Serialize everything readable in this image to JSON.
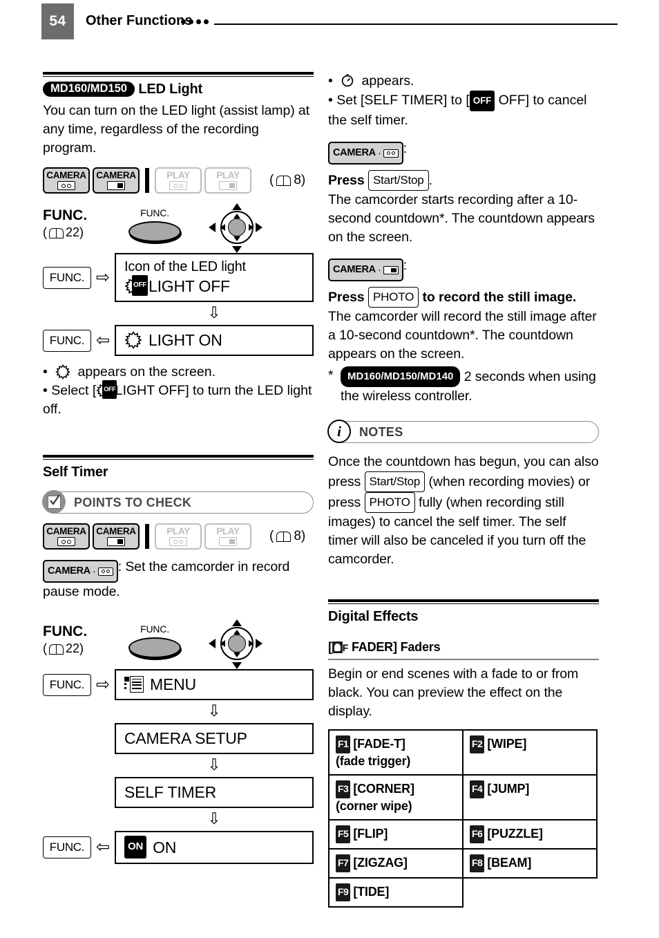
{
  "header": {
    "page_number": "54",
    "title": "Other Functions",
    "dot_count": 4
  },
  "mode_chips": {
    "camera_tape": "CAMERA",
    "camera_card": "CAMERA",
    "play_tape": "PLAY",
    "play_card": "PLAY",
    "page_ref": "8)",
    "paren_open": "("
  },
  "func_block": {
    "label": "FUNC.",
    "page_ref_open": "(",
    "page_ref": "22)",
    "button_caption": "FUNC.",
    "key_label": "FUNC."
  },
  "left_column": {
    "led_light": {
      "model_badge": "MD160/MD150",
      "heading": "LED Light",
      "body": "You can turn on the LED light (assist lamp) at any time, regardless of the recording program.",
      "flow": {
        "step1_caption": "Icon of the LED light",
        "step1_label": "LIGHT OFF",
        "step1_icon": "led-light-off-icon",
        "step2_label": "LIGHT ON",
        "step2_icon": "led-light-on-icon",
        "arrow_right": "⇨",
        "arrow_left": "⇦",
        "arrow_down": "⇩"
      },
      "notes": [
        {
          "icon": "led-light-on-icon",
          "text_after": "appears on the screen."
        },
        {
          "text_before": "Select [",
          "icon": "led-light-off-icon",
          "text_after": "LIGHT OFF]  to turn the LED light off."
        }
      ]
    },
    "self_timer": {
      "heading": "Self Timer",
      "points_to_check": "POINTS TO CHECK",
      "points_icon": "checkbox-check-icon",
      "requirement_text": ": Set the camcorder in record pause mode.",
      "flow": {
        "step1_label": "MENU",
        "step1_icon": "menu-list-icon",
        "step2_label": "CAMERA SETUP",
        "step3_label": "SELF TIMER",
        "step4_label": "ON",
        "step4_badge": "ON"
      }
    }
  },
  "right_column": {
    "self_timer_cont": {
      "bullet1_icon": "self-timer-icon",
      "bullet1_text": "appears.",
      "bullet2_before": "Set [SELF TIMER] to [",
      "bullet2_badge": "OFF",
      "bullet2_after": "OFF] to cancel the self timer.",
      "mode_tape_colon": ":",
      "press_label": "Press",
      "start_stop_key": "Start/Stop",
      "after_key_period": ".",
      "tape_body": "The camcorder starts recording after a 10-second countdown*. The countdown appears on the screen.",
      "mode_card_colon": ":",
      "photo_key": "PHOTO",
      "photo_press_bold_tail": "to record the still image.",
      "card_body": "The camcorder will record the still image after a 10-second countdown*. The countdown appears on the screen.",
      "footnote_star": "*",
      "footnote_badge": "MD160/MD150/MD140",
      "footnote_text": "2 seconds when using the wireless controller."
    },
    "notes": {
      "label": "NOTES",
      "icon": "info-circle-icon",
      "text_part1": "Once the countdown has begun, you can also press",
      "key1": "Start/Stop",
      "text_part2": "(when recording movies) or press",
      "key2": "PHOTO",
      "text_part3": "fully (when recording still images) to cancel the self timer. The self timer will also be canceled if you turn off the camcorder."
    },
    "digital_effects": {
      "heading": "Digital Effects",
      "sub_open": "[",
      "sub_icon": "fader-icon",
      "sub_icon_letter": "F",
      "sub_heading": "FADER] Faders",
      "body": "Begin or end scenes with a fade to or from black. You can preview the effect on the display.",
      "faders": [
        {
          "key": "F1",
          "label": "[FADE-T]",
          "sub": "(fade trigger)"
        },
        {
          "key": "F2",
          "label": "[WIPE]",
          "sub": ""
        },
        {
          "key": "F3",
          "label": "[CORNER]",
          "sub": "(corner wipe)"
        },
        {
          "key": "F4",
          "label": "[JUMP]",
          "sub": ""
        },
        {
          "key": "F5",
          "label": "[FLIP]",
          "sub": ""
        },
        {
          "key": "F6",
          "label": "[PUZZLE]",
          "sub": ""
        },
        {
          "key": "F7",
          "label": "[ZIGZAG]",
          "sub": ""
        },
        {
          "key": "F8",
          "label": "[BEAM]",
          "sub": ""
        },
        {
          "key": "F9",
          "label": "[TIDE]",
          "sub": ""
        }
      ]
    }
  },
  "colors": {
    "page_number_bg": "#6d6d6d",
    "chip_bg": "#d2d2d2",
    "disabled": "#bdbdbd",
    "callout_border": "#8a8a8a"
  }
}
